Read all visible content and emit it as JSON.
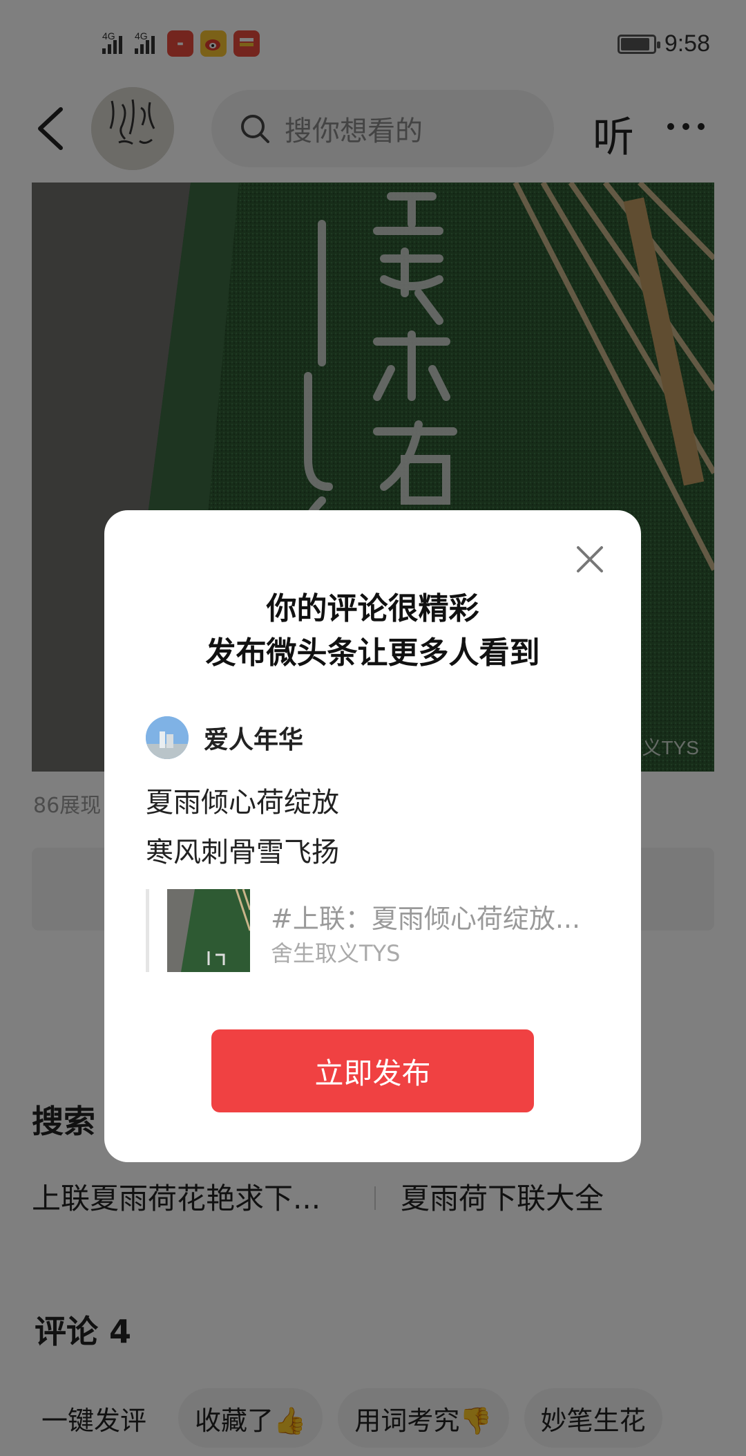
{
  "status_bar": {
    "network_1": "4G",
    "network_2": "4G",
    "battery_percent": 90,
    "time": "9:58",
    "app_icons": [
      "huawei-store-icon",
      "weibo-icon",
      "news-app-icon"
    ]
  },
  "header": {
    "search_placeholder": "搜你想看的",
    "listen_label": "听"
  },
  "article": {
    "image_watermark": "义TYS",
    "meta": "86展现"
  },
  "search_section": {
    "title": "搜索",
    "related": [
      "上联夏雨荷花艳求下...",
      "夏雨荷下联大全"
    ]
  },
  "comments": {
    "title": "评论 4"
  },
  "chips": [
    "一键发评",
    "收藏了👍",
    "用词考究👎",
    "妙笔生花"
  ],
  "dialog": {
    "title_line1": "你的评论很精彩",
    "title_line2": "发布微头条让更多人看到",
    "user_name": "爱人年华",
    "comment_line1": "夏雨倾心荷绽放",
    "comment_line2": "寒风刺骨雪飞扬",
    "quote_title": "#上联：夏雨倾心荷绽放...",
    "quote_author": "舍生取义TYS",
    "publish_label": "立即发布"
  },
  "colors": {
    "accent": "#f04142",
    "overlay": "rgba(0,0,0,0.5)"
  }
}
